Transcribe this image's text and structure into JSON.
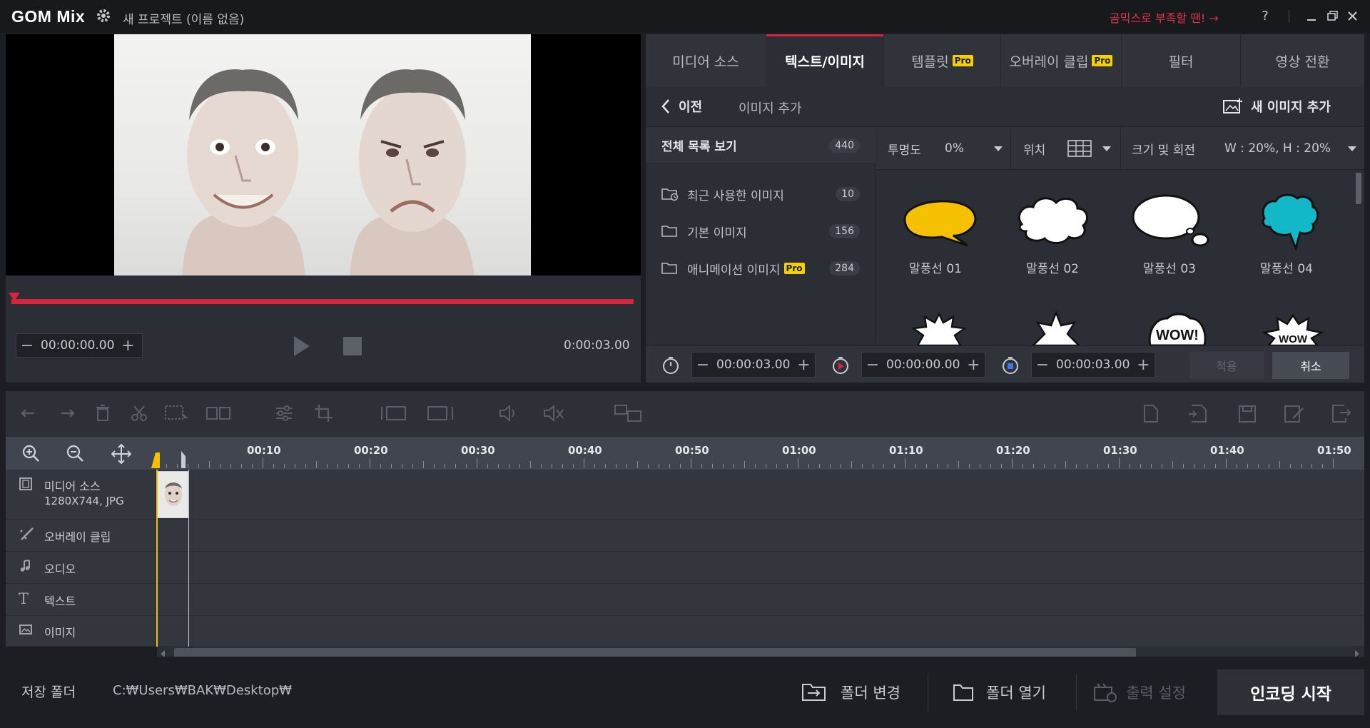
{
  "app": {
    "title": "GOM Mix",
    "project": "새 프로젝트 (이름 없음)",
    "promo": "곰믹스로 부족할 땐! →",
    "help": "?"
  },
  "preview": {
    "start_time": "00:00:00.00",
    "total_time": "0:00:03.00",
    "progress": 0.0
  },
  "tabs": [
    {
      "label": "미디어 소스"
    },
    {
      "label": "텍스트/이미지",
      "active": true
    },
    {
      "label": "템플릿",
      "pro": "Pro"
    },
    {
      "label": "오버레이 클립",
      "pro": "Pro"
    },
    {
      "label": "필터"
    },
    {
      "label": "영상 전환"
    }
  ],
  "subbar": {
    "back": "이전",
    "section": "이미지 추가",
    "add_new": "새 이미지 추가"
  },
  "categories": {
    "all": {
      "label": "전체 목록 보기",
      "count": "440"
    },
    "items": [
      {
        "label": "최근 사용한 이미지",
        "count": "10"
      },
      {
        "label": "기본 이미지",
        "count": "156"
      },
      {
        "label": "애니메이션 이미지",
        "count": "284",
        "pro": "Pro"
      }
    ]
  },
  "controls": {
    "opacity_label": "투명도",
    "opacity_value": "0%",
    "position_label": "위치",
    "size_label": "크기 및 회전",
    "size_value": "W : 20%, H : 20%"
  },
  "images": [
    {
      "label": "말풍선 01",
      "color": "#f5c000"
    },
    {
      "label": "말풍선 02",
      "color": "#ffffff"
    },
    {
      "label": "말풍선 03",
      "color": "#ffffff"
    },
    {
      "label": "말풍선 04",
      "color": "#13b8c8"
    }
  ],
  "row2_text": {
    "wow1": "WOW!",
    "wow2": "WOW"
  },
  "timing": {
    "duration": "00:00:03.00",
    "start": "00:00:00.00",
    "end": "00:00:03.00",
    "apply": "적용",
    "cancel": "취소"
  },
  "timeline": {
    "ticks": [
      "00:10",
      "00:20",
      "00:30",
      "00:40",
      "00:50",
      "01:00",
      "01:10",
      "01:20",
      "01:30",
      "01:40",
      "01:50"
    ],
    "tracks": [
      {
        "label": "미디어 소스",
        "sub": "1280X744, JPG"
      },
      {
        "label": "오버레이 클립"
      },
      {
        "label": "오디오"
      },
      {
        "label": "텍스트"
      },
      {
        "label": "이미지"
      }
    ]
  },
  "status": {
    "folder_label": "저장 폴더",
    "folder_path": "C:₩Users₩BAK₩Desktop₩",
    "change_folder": "폴더 변경",
    "open_folder": "폴더 열기",
    "output_settings": "출력 설정",
    "encode": "인코딩 시작"
  },
  "colors": {
    "accent": "#d6253d",
    "pro_badge": "#f5d000",
    "playhead": "#f5c000"
  }
}
